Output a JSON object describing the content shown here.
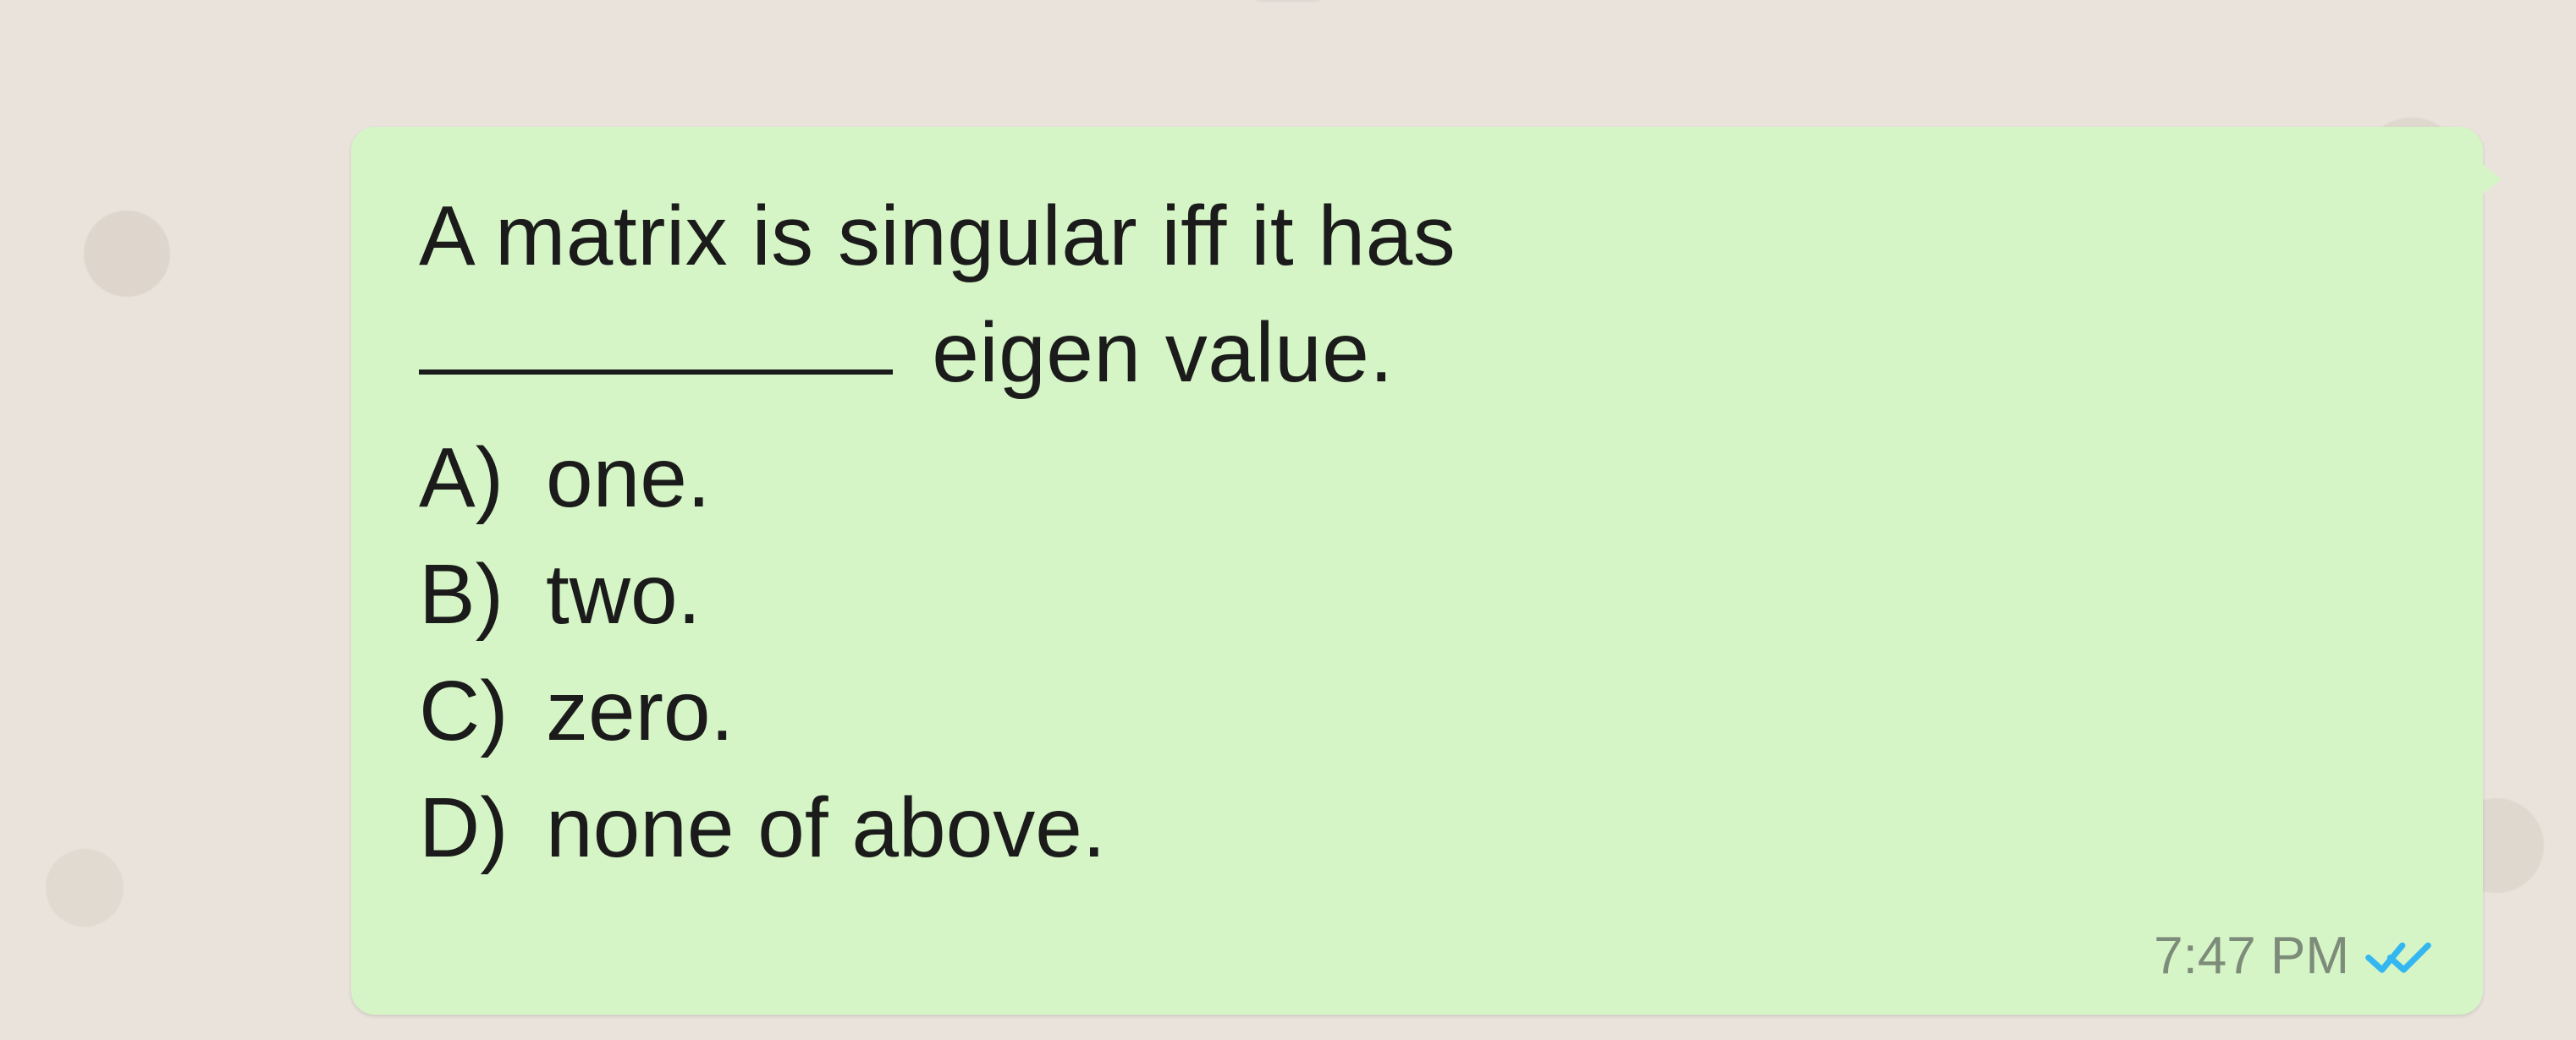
{
  "message": {
    "question_line1": "A matrix is  singular iff it has",
    "question_line2_suffix": "eigen value.",
    "options": [
      {
        "label": "A)",
        "text": "one."
      },
      {
        "label": "B)",
        "text": "two."
      },
      {
        "label": "C)",
        "text": "zero."
      },
      {
        "label": "D)",
        "text": "none of above."
      }
    ],
    "timestamp": "7:47 PM",
    "status": "read"
  }
}
